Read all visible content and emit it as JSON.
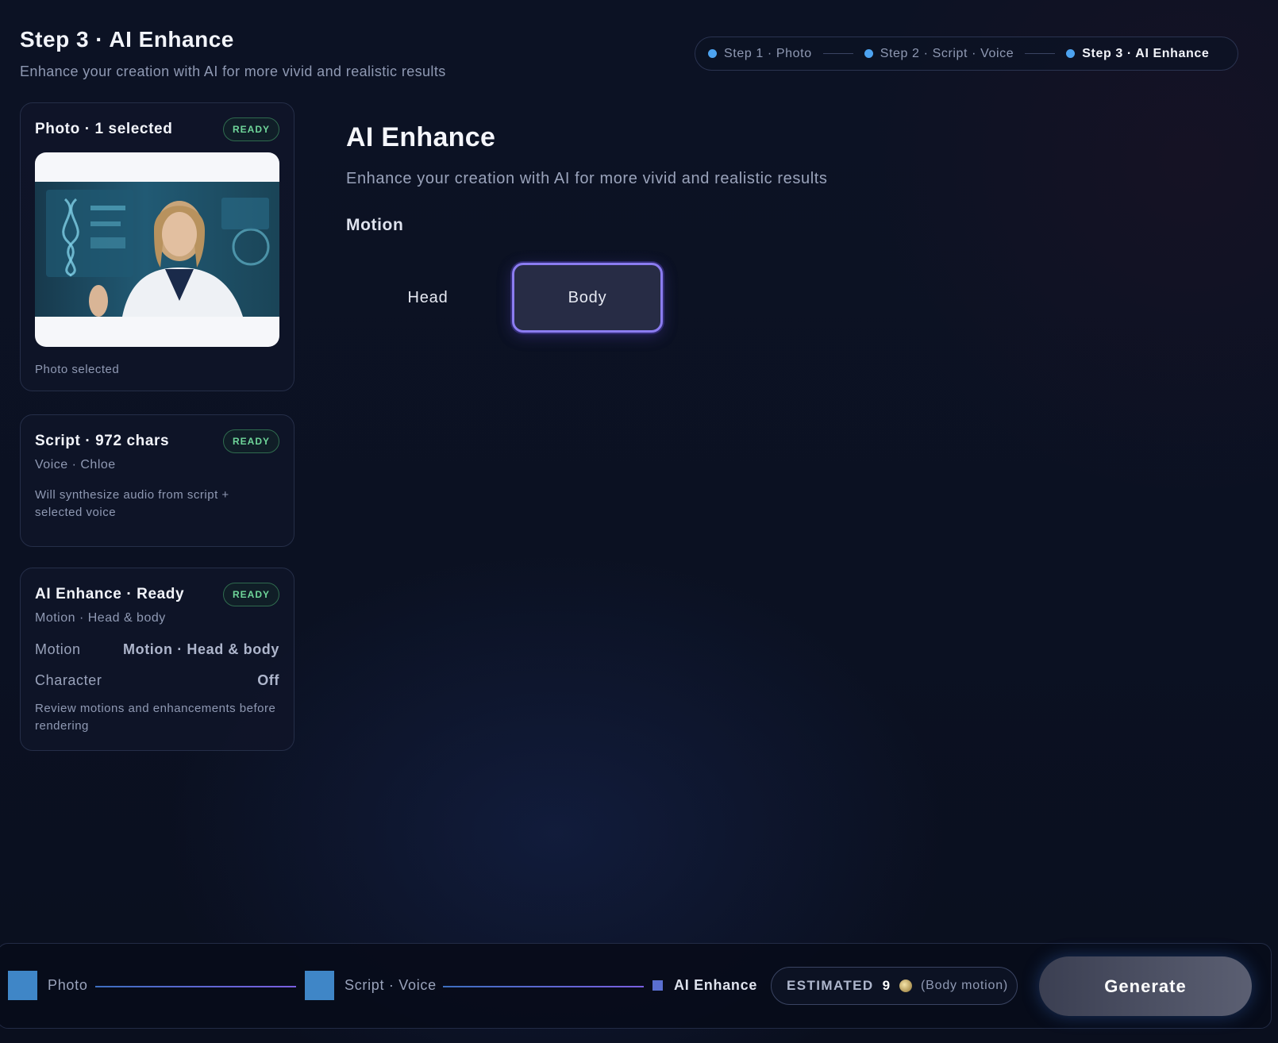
{
  "header": {
    "title": "Step 3 · AI Enhance",
    "subtitle": "Enhance your creation with AI for more vivid and realistic results"
  },
  "stepper": {
    "steps": [
      {
        "label": "Step 1 · Photo",
        "active": false
      },
      {
        "label": "Step 2 · Script · Voice",
        "active": false
      },
      {
        "label": "Step 3 · AI Enhance",
        "active": true
      }
    ]
  },
  "cards": {
    "photo": {
      "title": "Photo · 1 selected",
      "badge": "READY",
      "note": "Photo selected"
    },
    "script": {
      "title": "Script · 972 chars",
      "badge": "READY",
      "sub": "Voice · Chloe",
      "note": "Will synthesize audio from script + selected voice"
    },
    "enhance": {
      "title": "AI Enhance · Ready",
      "badge": "READY",
      "sub": "Motion · Head & body",
      "rows": [
        {
          "label": "Motion",
          "value": "Motion · Head & body"
        },
        {
          "label": "Character",
          "value": "Off"
        }
      ],
      "note": "Review motions and enhancements before rendering"
    }
  },
  "main": {
    "title": "AI Enhance",
    "subtitle": "Enhance your creation with AI for more vivid and realistic results",
    "section_label": "Motion",
    "options": [
      {
        "label": "Head",
        "selected": false
      },
      {
        "label": "Body",
        "selected": true
      }
    ]
  },
  "bottom": {
    "steps": [
      {
        "label": "Photo"
      },
      {
        "label": "Script · Voice"
      },
      {
        "label": "AI Enhance"
      }
    ],
    "estimate_label": "ESTIMATED",
    "estimate_value": "9",
    "estimate_note": "(Body motion)",
    "generate_label": "Generate"
  },
  "colors": {
    "accent": "#8b7cf0",
    "step_dot": "#4da3f0",
    "ready": "#6fd69a",
    "background": "#0b1020"
  },
  "icons": {
    "step": "dot-icon",
    "credits": "coin-icon"
  }
}
